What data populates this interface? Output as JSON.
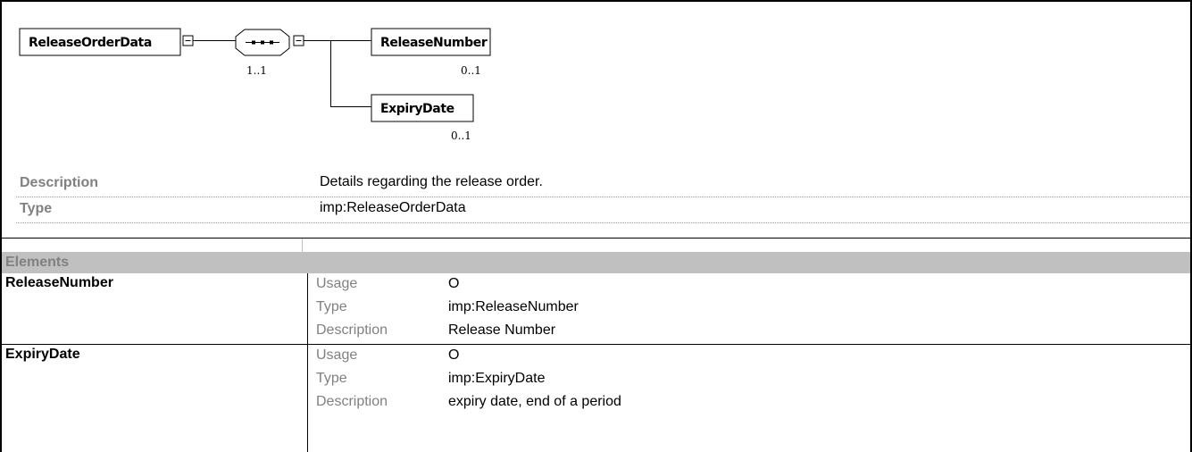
{
  "diagram": {
    "root": "ReleaseOrderData",
    "sequence_cardinality": "1..1",
    "children": [
      {
        "name": "ReleaseNumber",
        "cardinality": "0..1"
      },
      {
        "name": "ExpiryDate",
        "cardinality": "0..1"
      }
    ]
  },
  "properties": [
    {
      "key": "Description",
      "value": "Details regarding the release order."
    },
    {
      "key": "Type",
      "value": "imp:ReleaseOrderData"
    }
  ],
  "elements_section": {
    "title": "Elements",
    "items": [
      {
        "name": "ReleaseNumber",
        "fields": [
          {
            "label": "Usage",
            "value": "O"
          },
          {
            "label": "Type",
            "value": "imp:ReleaseNumber"
          },
          {
            "label": "Description",
            "value": "Release Number"
          }
        ]
      },
      {
        "name": "ExpiryDate",
        "fields": [
          {
            "label": "Usage",
            "value": "O"
          },
          {
            "label": "Type",
            "value": "imp:ExpiryDate"
          },
          {
            "label": "Description",
            "value": "expiry date, end of a period"
          }
        ]
      }
    ]
  }
}
